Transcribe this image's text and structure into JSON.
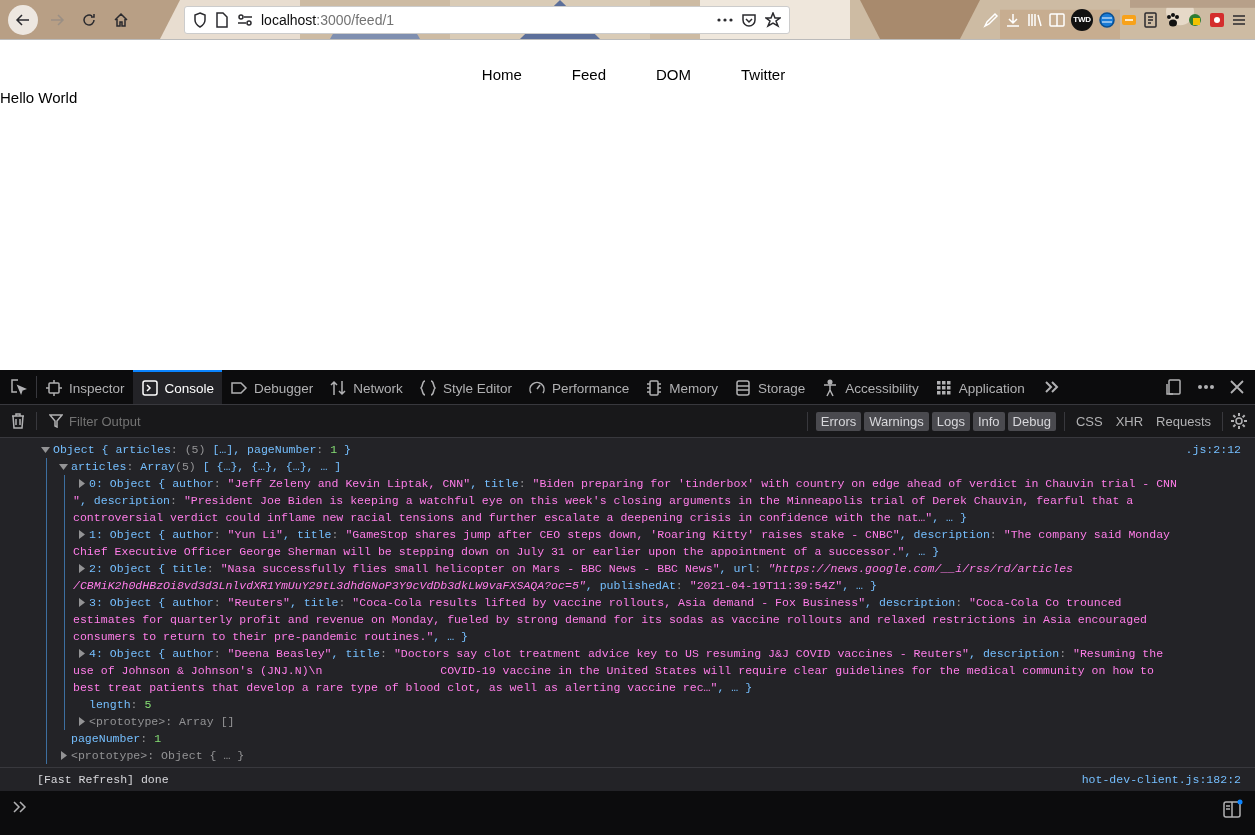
{
  "browser": {
    "url": {
      "host": "localhost",
      "path": ":3000/feed/1"
    },
    "badge": "TWD"
  },
  "page": {
    "nav": [
      "Home",
      "Feed",
      "DOM",
      "Twitter"
    ],
    "heading": "Hello World"
  },
  "devtools": {
    "tabs": [
      {
        "label": "Inspector",
        "selected": false
      },
      {
        "label": "Console",
        "selected": true
      },
      {
        "label": "Debugger",
        "selected": false
      },
      {
        "label": "Network",
        "selected": false
      },
      {
        "label": "Style Editor",
        "selected": false
      },
      {
        "label": "Performance",
        "selected": false
      },
      {
        "label": "Memory",
        "selected": false
      },
      {
        "label": "Storage",
        "selected": false
      },
      {
        "label": "Accessibility",
        "selected": false
      },
      {
        "label": "Application",
        "selected": false
      }
    ],
    "filter": {
      "placeholder": "Filter Output"
    },
    "levels": [
      {
        "label": "Errors",
        "selected": true
      },
      {
        "label": "Warnings",
        "selected": true
      },
      {
        "label": "Logs",
        "selected": true
      },
      {
        "label": "Info",
        "selected": true
      },
      {
        "label": "Debug",
        "selected": true
      }
    ],
    "requests": [
      {
        "label": "CSS",
        "selected": false
      },
      {
        "label": "XHR",
        "selected": false
      },
      {
        "label": "Requests",
        "selected": false
      }
    ],
    "messages": [
      {
        "kind": "tree",
        "source": ".js:2:12",
        "tree": {
          "kind": "expandable",
          "expanded": true,
          "segments": [
            {
              "kind": "plain",
              "text": "Object { "
            },
            {
              "kind": "key",
              "text": "articles"
            },
            {
              "kind": "punct",
              "text": ": "
            },
            {
              "kind": "dim",
              "text": "(5) "
            },
            {
              "kind": "plain",
              "text": "[…], "
            },
            {
              "kind": "key",
              "text": "pageNumber"
            },
            {
              "kind": "punct",
              "text": ": "
            },
            {
              "kind": "number",
              "text": "1"
            },
            {
              "kind": "plain",
              "text": " }"
            }
          ],
          "children": [
            {
              "kind": "expandable",
              "expanded": true,
              "segments": [
                {
                  "kind": "key",
                  "text": "articles"
                },
                {
                  "kind": "punct",
                  "text": ": "
                },
                {
                  "kind": "plain",
                  "text": "Array"
                },
                {
                  "kind": "dim",
                  "text": "(5) "
                },
                {
                  "kind": "plain",
                  "text": "[ {…}, {…}, {…}, … ]"
                }
              ],
              "children": [
                {
                  "kind": "expandable",
                  "expanded": false,
                  "segments": [
                    {
                      "kind": "plain",
                      "text": "0: Object { "
                    },
                    {
                      "kind": "key",
                      "text": "author"
                    },
                    {
                      "kind": "punct",
                      "text": ": "
                    },
                    {
                      "kind": "string",
                      "text": "\"Jeff Zeleny and Kevin Liptak, CNN\""
                    },
                    {
                      "kind": "plain",
                      "text": ", "
                    },
                    {
                      "kind": "key",
                      "text": "title"
                    },
                    {
                      "kind": "punct",
                      "text": ": "
                    },
                    {
                      "kind": "string",
                      "text": "\"Biden preparing for 'tinderbox' with country on edge ahead of verdict in Chauvin trial - CNN \""
                    },
                    {
                      "kind": "plain",
                      "text": ", "
                    },
                    {
                      "kind": "key",
                      "text": "description"
                    },
                    {
                      "kind": "punct",
                      "text": ": "
                    },
                    {
                      "kind": "string",
                      "text": "\"President Joe Biden is keeping a watchful eye on this week's closing arguments in the Minneapolis trial of Derek Chauvin, fearful that a controversial verdict could inflame new racial tensions and further escalate a deepening crisis in confidence with the nat…\""
                    },
                    {
                      "kind": "plain",
                      "text": ", … }"
                    }
                  ]
                },
                {
                  "kind": "expandable",
                  "expanded": false,
                  "segments": [
                    {
                      "kind": "plain",
                      "text": "1: Object { "
                    },
                    {
                      "kind": "key",
                      "text": "author"
                    },
                    {
                      "kind": "punct",
                      "text": ": "
                    },
                    {
                      "kind": "string",
                      "text": "\"Yun Li\""
                    },
                    {
                      "kind": "plain",
                      "text": ", "
                    },
                    {
                      "kind": "key",
                      "text": "title"
                    },
                    {
                      "kind": "punct",
                      "text": ": "
                    },
                    {
                      "kind": "string",
                      "text": "\"GameStop shares jump after CEO steps down, 'Roaring Kitty' raises stake - CNBC\""
                    },
                    {
                      "kind": "plain",
                      "text": ", "
                    },
                    {
                      "kind": "key",
                      "text": "description"
                    },
                    {
                      "kind": "punct",
                      "text": ": "
                    },
                    {
                      "kind": "string",
                      "text": "\"The company said Monday Chief Executive Officer George Sherman will be stepping down on July 31 or earlier upon the appointment of a successor.\""
                    },
                    {
                      "kind": "plain",
                      "text": ", … }"
                    }
                  ]
                },
                {
                  "kind": "expandable",
                  "expanded": false,
                  "segments": [
                    {
                      "kind": "plain",
                      "text": "2: Object { "
                    },
                    {
                      "kind": "key",
                      "text": "title"
                    },
                    {
                      "kind": "punct",
                      "text": ": "
                    },
                    {
                      "kind": "string",
                      "text": "\"Nasa successfully flies small helicopter on Mars - BBC News - BBC News\""
                    },
                    {
                      "kind": "plain",
                      "text": ", "
                    },
                    {
                      "kind": "key",
                      "text": "url"
                    },
                    {
                      "kind": "punct",
                      "text": ": "
                    },
                    {
                      "kind": "url",
                      "text": "\"https://news.google.com/__i/rss/rd/articles /CBMiK2h0dHBzOi8vd3d3LnlvdXR1YmUuY29tL3dhdGNoP3Y9cVdDb3dkLW9vaFXSAQA?oc=5\""
                    },
                    {
                      "kind": "plain",
                      "text": ", "
                    },
                    {
                      "kind": "key",
                      "text": "publishedAt"
                    },
                    {
                      "kind": "punct",
                      "text": ": "
                    },
                    {
                      "kind": "string",
                      "text": "\"2021-04-19T11:39:54Z\""
                    },
                    {
                      "kind": "plain",
                      "text": ", … }"
                    }
                  ]
                },
                {
                  "kind": "expandable",
                  "expanded": false,
                  "segments": [
                    {
                      "kind": "plain",
                      "text": "3: Object { "
                    },
                    {
                      "kind": "key",
                      "text": "author"
                    },
                    {
                      "kind": "punct",
                      "text": ": "
                    },
                    {
                      "kind": "string",
                      "text": "\"Reuters\""
                    },
                    {
                      "kind": "plain",
                      "text": ", "
                    },
                    {
                      "kind": "key",
                      "text": "title"
                    },
                    {
                      "kind": "punct",
                      "text": ": "
                    },
                    {
                      "kind": "string",
                      "text": "\"Coca-Cola results lifted by vaccine rollouts, Asia demand - Fox Business\""
                    },
                    {
                      "kind": "plain",
                      "text": ", "
                    },
                    {
                      "kind": "key",
                      "text": "description"
                    },
                    {
                      "kind": "punct",
                      "text": ": "
                    },
                    {
                      "kind": "string",
                      "text": "\"Coca-Cola Co trounced estimates for quarterly profit and revenue on Monday, fueled by strong demand for its sodas as vaccine rollouts and relaxed restrictions in Asia encouraged consumers to return to their pre-pandemic routines.\""
                    },
                    {
                      "kind": "plain",
                      "text": ", … }"
                    }
                  ]
                },
                {
                  "kind": "expandable",
                  "expanded": false,
                  "segments": [
                    {
                      "kind": "plain",
                      "text": "4: Object { "
                    },
                    {
                      "kind": "key",
                      "text": "author"
                    },
                    {
                      "kind": "punct",
                      "text": ": "
                    },
                    {
                      "kind": "string",
                      "text": "\"Deena Beasley\""
                    },
                    {
                      "kind": "plain",
                      "text": ", "
                    },
                    {
                      "kind": "key",
                      "text": "title"
                    },
                    {
                      "kind": "punct",
                      "text": ": "
                    },
                    {
                      "kind": "string",
                      "text": "\"Doctors say clot treatment advice key to US resuming J&J COVID vaccines - Reuters\""
                    },
                    {
                      "kind": "plain",
                      "text": ", "
                    },
                    {
                      "kind": "key",
                      "text": "description"
                    },
                    {
                      "kind": "punct",
                      "text": ": "
                    },
                    {
                      "kind": "string",
                      "text": "\"Resuming the use of Johnson & Johnson's (JNJ.N)\\n                 COVID-19 vaccine in the United States will require clear guidelines for the medical community on how to best treat patients that develop a rare type of blood clot, as well as alerting vaccine rec…\""
                    },
                    {
                      "kind": "plain",
                      "text": ", … }"
                    }
                  ]
                },
                {
                  "kind": "leaf",
                  "segments": [
                    {
                      "kind": "key",
                      "text": "length"
                    },
                    {
                      "kind": "punct",
                      "text": ": "
                    },
                    {
                      "kind": "number",
                      "text": "5"
                    }
                  ]
                },
                {
                  "kind": "expandable",
                  "expanded": false,
                  "segments": [
                    {
                      "kind": "dim",
                      "text": "<prototype>: Array []"
                    }
                  ]
                }
              ]
            },
            {
              "kind": "leaf",
              "segments": [
                {
                  "kind": "key",
                  "text": "pageNumber"
                },
                {
                  "kind": "punct",
                  "text": ": "
                },
                {
                  "kind": "number",
                  "text": "1"
                }
              ]
            },
            {
              "kind": "expandable",
              "expanded": false,
              "segments": [
                {
                  "kind": "dim",
                  "text": "<prototype>: Object { … }"
                }
              ]
            }
          ]
        }
      },
      {
        "kind": "text",
        "text": "[Fast Refresh] done",
        "source": "hot-dev-client.js:182:2"
      }
    ]
  }
}
